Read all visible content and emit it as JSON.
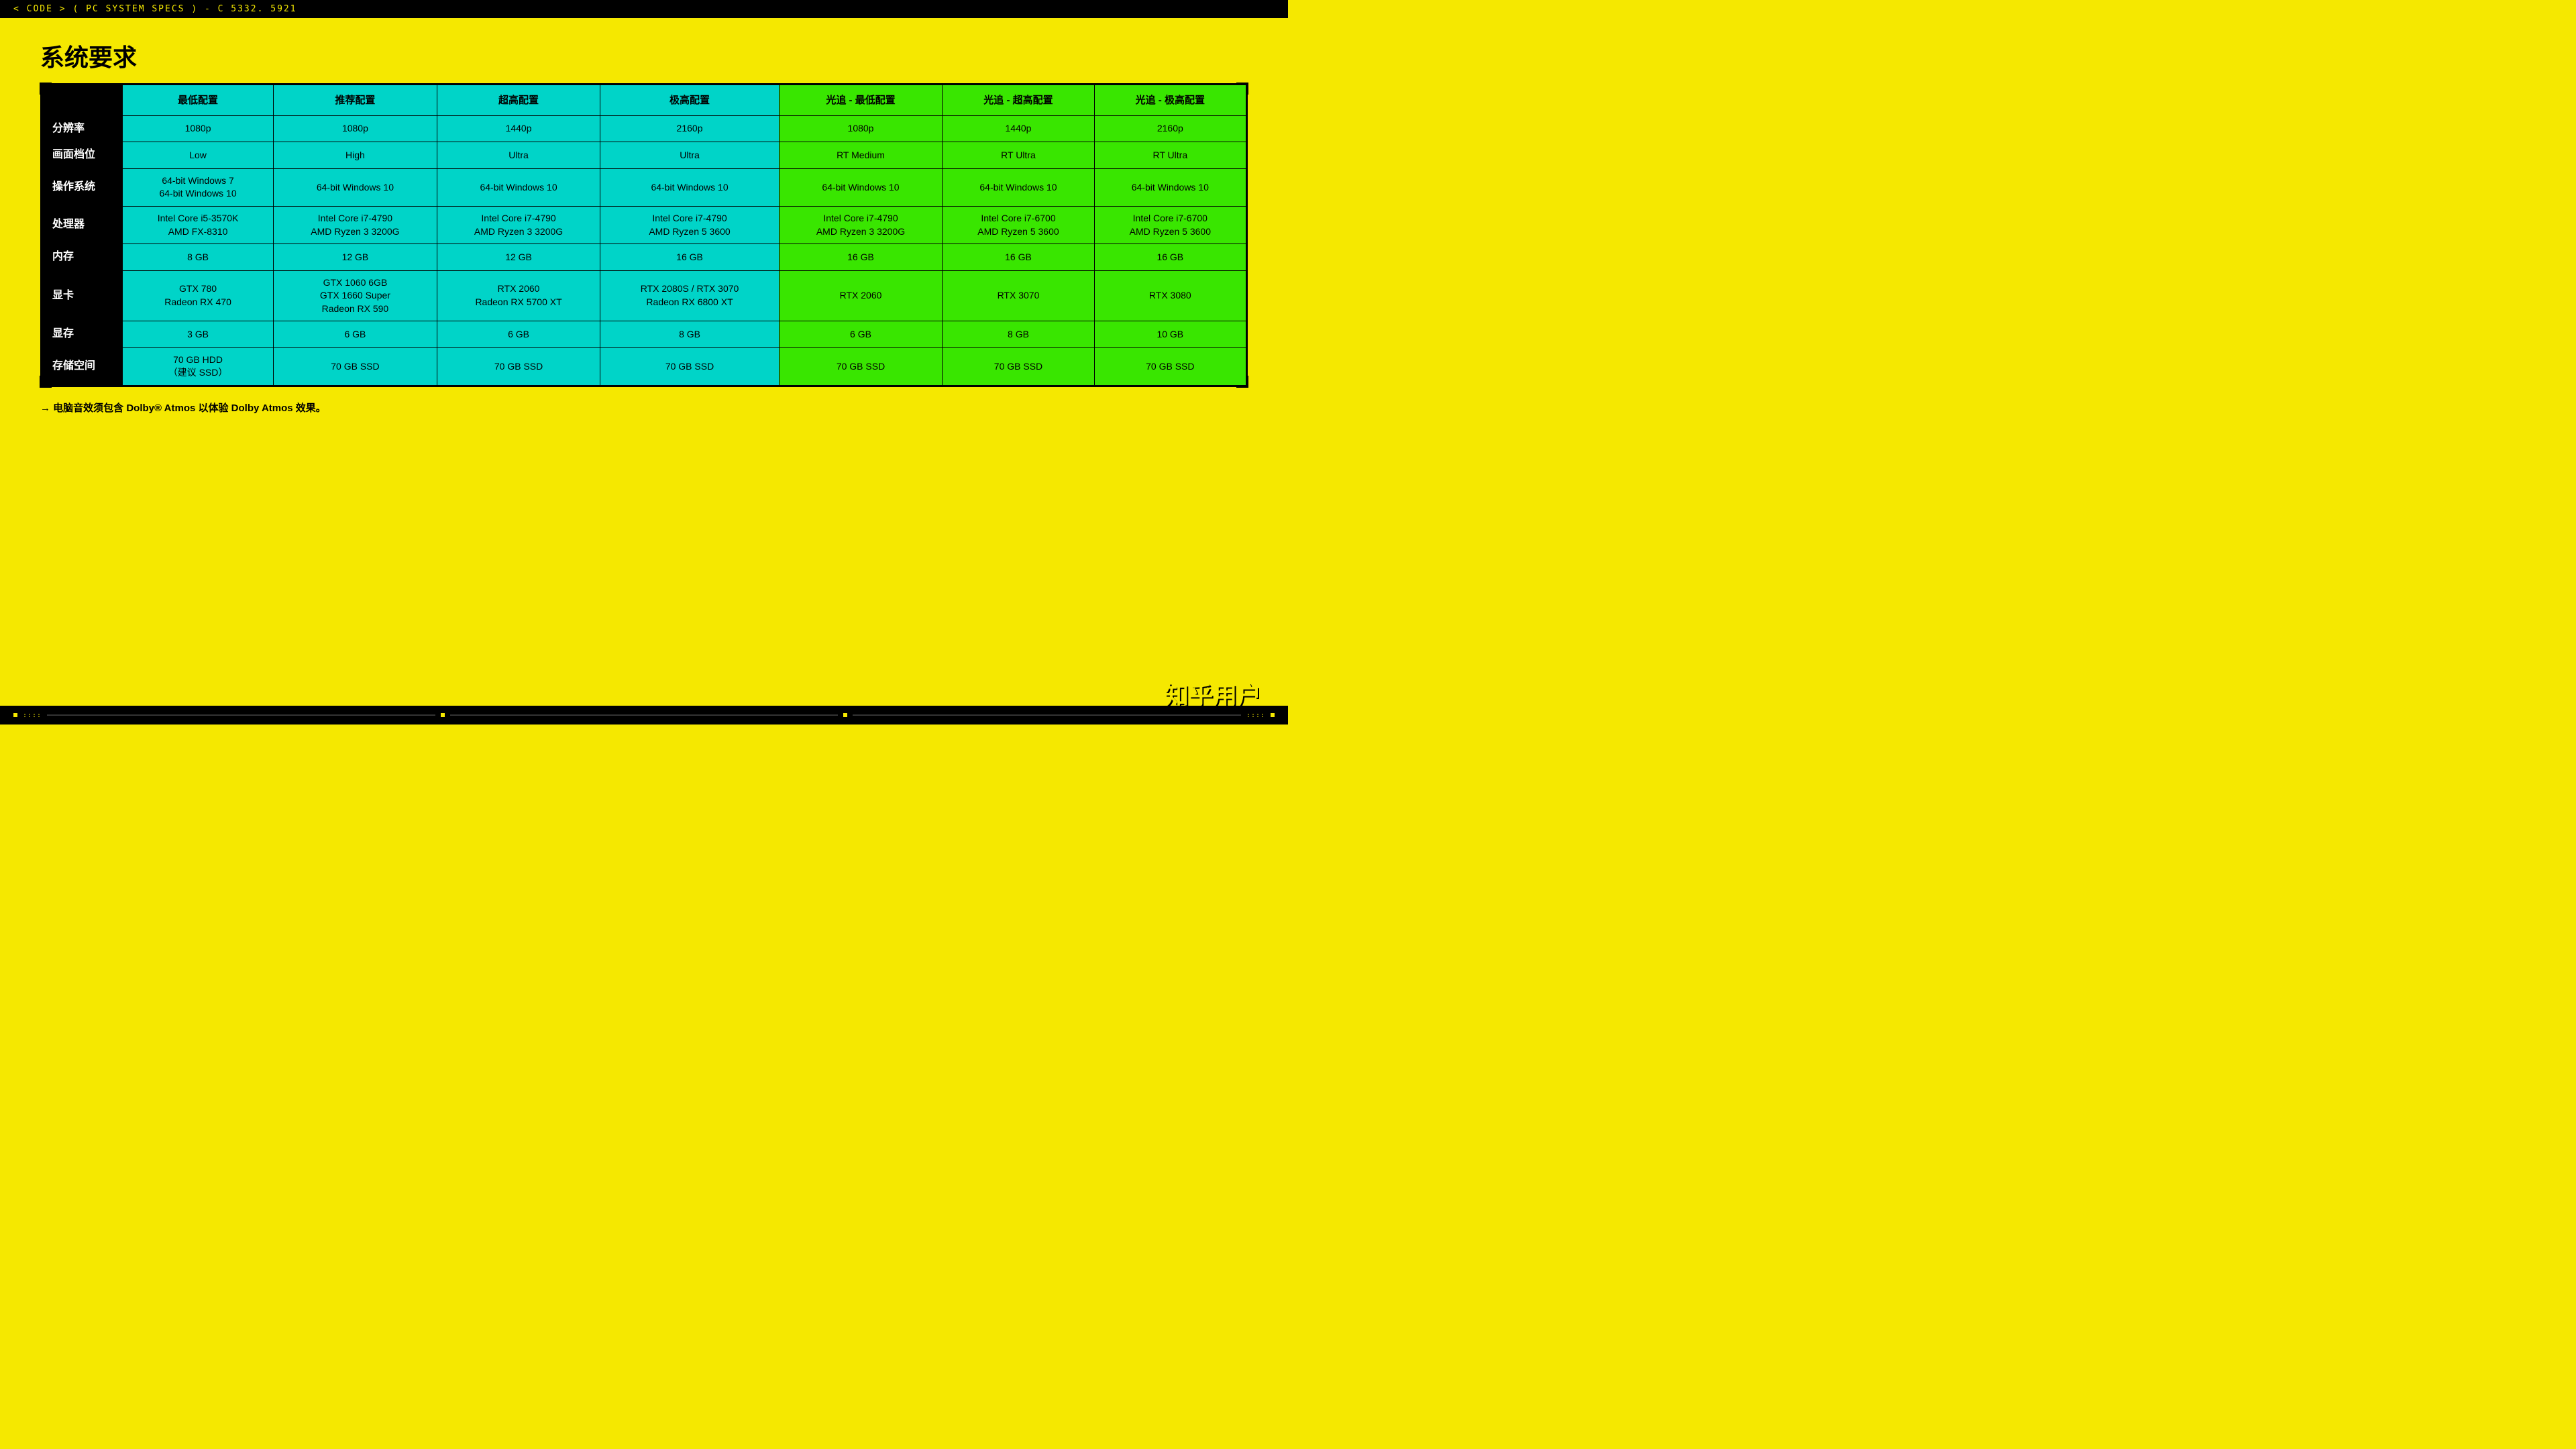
{
  "topbar": {
    "text": "< CODE > ( PC SYSTEM SPECS ) - C 5332. 5921"
  },
  "page": {
    "title": "系统要求"
  },
  "table": {
    "headers": [
      {
        "label": "",
        "type": "empty"
      },
      {
        "label": "最低配置",
        "type": "cyan"
      },
      {
        "label": "推荐配置",
        "type": "cyan"
      },
      {
        "label": "超高配置",
        "type": "cyan"
      },
      {
        "label": "极高配置",
        "type": "cyan"
      },
      {
        "label": "光追 - 最低配置",
        "type": "green"
      },
      {
        "label": "光追 - 超高配置",
        "type": "green"
      },
      {
        "label": "光追 - 极高配置",
        "type": "green"
      }
    ],
    "rows": [
      {
        "label": "分辨率",
        "cells": [
          {
            "text": "1080p",
            "type": "cyan"
          },
          {
            "text": "1080p",
            "type": "cyan"
          },
          {
            "text": "1440p",
            "type": "cyan"
          },
          {
            "text": "2160p",
            "type": "cyan"
          },
          {
            "text": "1080p",
            "type": "green"
          },
          {
            "text": "1440p",
            "type": "green"
          },
          {
            "text": "2160p",
            "type": "green"
          }
        ]
      },
      {
        "label": "画面档位",
        "cells": [
          {
            "text": "Low",
            "type": "cyan"
          },
          {
            "text": "High",
            "type": "cyan"
          },
          {
            "text": "Ultra",
            "type": "cyan"
          },
          {
            "text": "Ultra",
            "type": "cyan"
          },
          {
            "text": "RT Medium",
            "type": "green"
          },
          {
            "text": "RT Ultra",
            "type": "green"
          },
          {
            "text": "RT Ultra",
            "type": "green"
          }
        ]
      },
      {
        "label": "操作系统",
        "cells": [
          {
            "text": "64-bit Windows 7\n64-bit Windows 10",
            "type": "cyan"
          },
          {
            "text": "64-bit Windows 10",
            "type": "cyan"
          },
          {
            "text": "64-bit Windows 10",
            "type": "cyan"
          },
          {
            "text": "64-bit Windows 10",
            "type": "cyan"
          },
          {
            "text": "64-bit Windows 10",
            "type": "green"
          },
          {
            "text": "64-bit Windows 10",
            "type": "green"
          },
          {
            "text": "64-bit Windows 10",
            "type": "green"
          }
        ]
      },
      {
        "label": "处理器",
        "cells": [
          {
            "text": "Intel Core i5-3570K\nAMD FX-8310",
            "type": "cyan"
          },
          {
            "text": "Intel Core i7-4790\nAMD Ryzen 3 3200G",
            "type": "cyan"
          },
          {
            "text": "Intel Core i7-4790\nAMD Ryzen 3 3200G",
            "type": "cyan"
          },
          {
            "text": "Intel Core i7-4790\nAMD Ryzen 5 3600",
            "type": "cyan"
          },
          {
            "text": "Intel Core i7-4790\nAMD Ryzen 3 3200G",
            "type": "green"
          },
          {
            "text": "Intel Core i7-6700\nAMD Ryzen 5 3600",
            "type": "green"
          },
          {
            "text": "Intel Core i7-6700\nAMD Ryzen 5 3600",
            "type": "green"
          }
        ]
      },
      {
        "label": "内存",
        "cells": [
          {
            "text": "8 GB",
            "type": "cyan"
          },
          {
            "text": "12 GB",
            "type": "cyan"
          },
          {
            "text": "12 GB",
            "type": "cyan"
          },
          {
            "text": "16 GB",
            "type": "cyan"
          },
          {
            "text": "16 GB",
            "type": "green"
          },
          {
            "text": "16 GB",
            "type": "green"
          },
          {
            "text": "16 GB",
            "type": "green"
          }
        ]
      },
      {
        "label": "显卡",
        "cells": [
          {
            "text": "GTX 780\nRadeon RX 470",
            "type": "cyan"
          },
          {
            "text": "GTX 1060 6GB\nGTX 1660 Super\nRadeon RX 590",
            "type": "cyan"
          },
          {
            "text": "RTX 2060\nRadeon RX 5700 XT",
            "type": "cyan"
          },
          {
            "text": "RTX 2080S / RTX 3070\nRadeon RX 6800 XT",
            "type": "cyan"
          },
          {
            "text": "RTX 2060",
            "type": "green"
          },
          {
            "text": "RTX 3070",
            "type": "green"
          },
          {
            "text": "RTX 3080",
            "type": "green"
          }
        ]
      },
      {
        "label": "显存",
        "cells": [
          {
            "text": "3 GB",
            "type": "cyan"
          },
          {
            "text": "6 GB",
            "type": "cyan"
          },
          {
            "text": "6 GB",
            "type": "cyan"
          },
          {
            "text": "8 GB",
            "type": "cyan"
          },
          {
            "text": "6 GB",
            "type": "green"
          },
          {
            "text": "8 GB",
            "type": "green"
          },
          {
            "text": "10 GB",
            "type": "green"
          }
        ]
      },
      {
        "label": "存储空间",
        "cells": [
          {
            "text": "70 GB HDD\n（建议 SSD）",
            "type": "cyan"
          },
          {
            "text": "70 GB SSD",
            "type": "cyan"
          },
          {
            "text": "70 GB SSD",
            "type": "cyan"
          },
          {
            "text": "70 GB SSD",
            "type": "cyan"
          },
          {
            "text": "70 GB SSD",
            "type": "green"
          },
          {
            "text": "70 GB SSD",
            "type": "green"
          },
          {
            "text": "70 GB SSD",
            "type": "green"
          }
        ]
      }
    ]
  },
  "footer": {
    "note": "电脑音效须包含 Dolby® Atmos 以体验 Dolby Atmos 效果。"
  },
  "watermark": {
    "text": "知乎用户"
  }
}
